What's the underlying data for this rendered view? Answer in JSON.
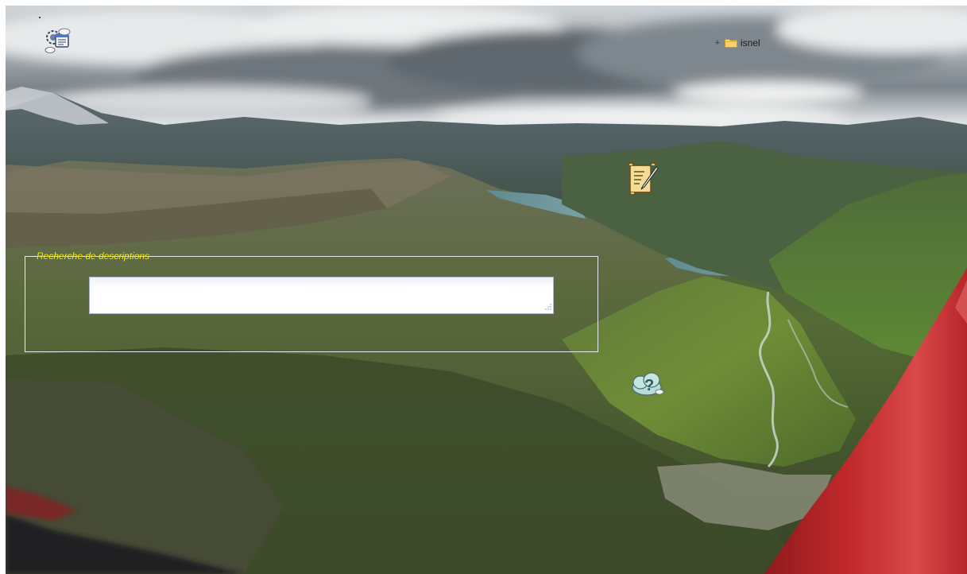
{
  "desktop": {
    "folder_label": "isnel",
    "expander_symbol": "+"
  },
  "search_panel": {
    "legend": "Recherche de descriptions",
    "textarea_value": ""
  },
  "icons": {
    "app_icon": "weather-calendar-icon",
    "folder_icon": "folder-icon",
    "note_icon": "note-quill-icon",
    "help_icon": "help-cloud-icon",
    "expander_icon": "plus-expander-icon"
  },
  "colors": {
    "legend_text": "#f6f200",
    "fieldset_border": "#e6e9ee",
    "folder_yellow": "#f2c84b",
    "wing_red": "#c0282a"
  }
}
